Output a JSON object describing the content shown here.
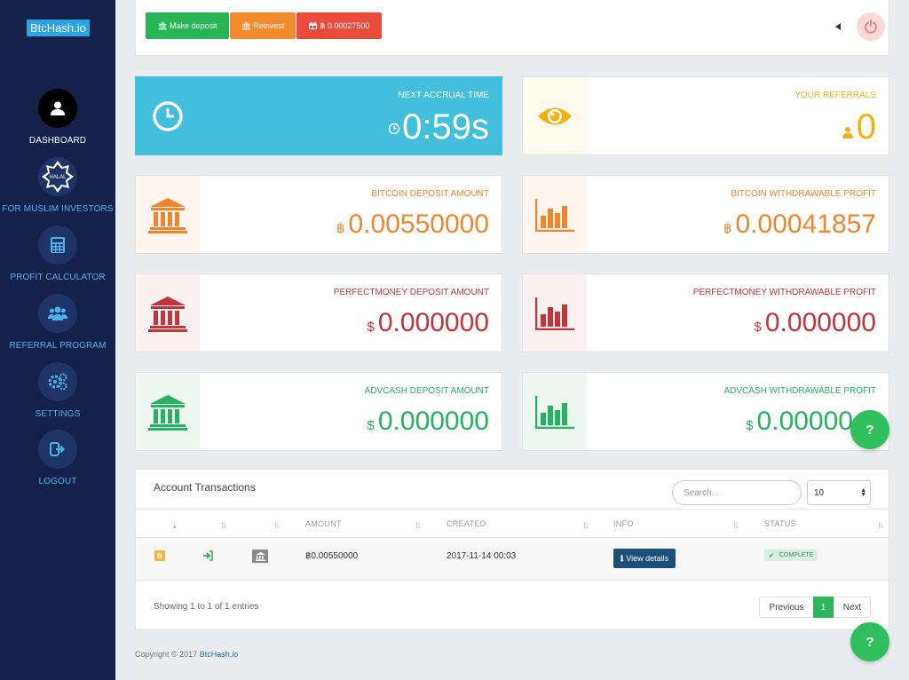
{
  "brand": {
    "logo": "BtcHash.io"
  },
  "sidebar": {
    "items": [
      {
        "label": "DASHBOARD",
        "icon": "user-icon"
      },
      {
        "label": "FOR MUSLIM INVESTORS",
        "icon": "halal-icon"
      },
      {
        "label": "PROFIT CALCULATOR",
        "icon": "calculator-icon"
      },
      {
        "label": "REFERRAL PROGRAM",
        "icon": "users-icon"
      },
      {
        "label": "SETTINGS",
        "icon": "gears-icon"
      },
      {
        "label": "LOGOUT",
        "icon": "logout-icon"
      }
    ],
    "halal_text": "HALAL"
  },
  "toolbar": {
    "deposit_label": "Make deposit",
    "reinvest_label": "Reinvest",
    "balance_label": "฿ 0.00027500"
  },
  "cards": {
    "accrual": {
      "title": "NEXT ACCRUAL TIME",
      "value": "0:59s"
    },
    "referrals": {
      "title": "YOUR REFERRALS",
      "value": "0"
    },
    "btc_deposit": {
      "title": "BITCOIN DEPOSIT AMOUNT",
      "currency": "฿",
      "value": "0.00550000"
    },
    "btc_profit": {
      "title": "BITCOIN WITHDRAWABLE PROFIT",
      "currency": "฿",
      "value": "0.00041857"
    },
    "pm_deposit": {
      "title": "PERFECTMONEY DEPOSIT AMOUNT",
      "currency": "$",
      "value": "0.000000"
    },
    "pm_profit": {
      "title": "PERFECTMONEY WITHDRAWABLE PROFIT",
      "currency": "$",
      "value": "0.000000"
    },
    "adv_deposit": {
      "title": "ADVCASH DEPOSIT AMOUNT",
      "currency": "$",
      "value": "0.000000"
    },
    "adv_profit": {
      "title": "ADVCASH WITHDRAWABLE PROFIT",
      "currency": "$",
      "value": "0.00000"
    }
  },
  "transactions": {
    "title": "Account Transactions",
    "search_placeholder": "Search...",
    "page_size": "10",
    "columns": [
      "",
      "",
      "",
      "AMOUNT",
      "CREATED",
      "INFO",
      "STATUS"
    ],
    "rows": [
      {
        "coin": "B",
        "amount": "฿0.00550000",
        "created": "2017-11-14 00:03",
        "info_button": "View details",
        "status": "COMPLETE"
      }
    ],
    "showing": "Showing 1 to 1 of 1 entries",
    "pagination": {
      "prev": "Previous",
      "current": "1",
      "next": "Next"
    }
  },
  "footer": {
    "copyright": "Copyright © 2017",
    "link": "BtcHash.io"
  },
  "help": {
    "label": "?"
  },
  "colors": {
    "sidebar": "#14224a",
    "accent_blue": "#41bfdc",
    "orange": "#f0852b",
    "red": "#c0343a",
    "green": "#25b35f",
    "yellow": "#f3b00f"
  }
}
